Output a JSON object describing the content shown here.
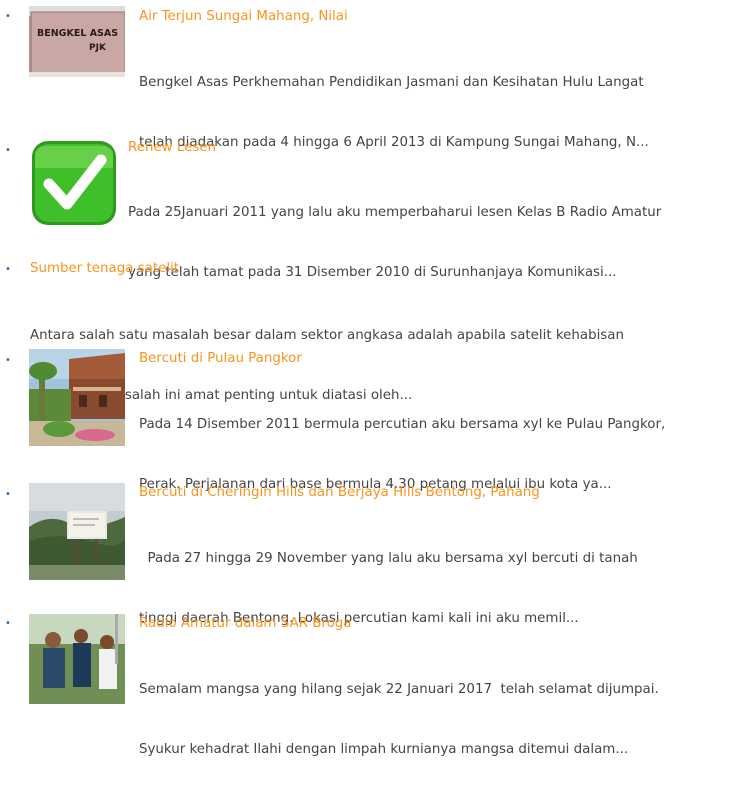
{
  "posts": [
    {
      "title": "Air Terjun Sungai Mahang, Nilai",
      "line1": "Bengkel Asas Perkhemahan Pendidikan Jasmani dan Kesihatan Hulu Langat",
      "line2": "telah diadakan pada 4 hingga 6 April 2013 di Kampung Sungai Mahang, N...",
      "thumb_text": [
        "BENGKEL ASAS",
        "PJK"
      ]
    },
    {
      "title": "Renew Lesen",
      "line1": "Pada 25Januari 2011 yang lalu aku memperbaharui lesen Kelas B Radio Amatur",
      "line2": "yang telah tamat pada 31 Disember 2010 di Surunhanjaya Komunikasi..."
    },
    {
      "title": "Sumber tenaga satelit",
      "line1": "Antara salah satu masalah besar dalam sektor angkasa adalah apabila satelit kehabisan",
      "line2": "bahan api. Masalah ini amat penting untuk diatasi oleh..."
    },
    {
      "title": "Bercuti di Pulau Pangkor",
      "line1": "Pada 14 Disember 2011 bermula percutian aku bersama xyl ke Pulau Pangkor,",
      "line2": "Perak. Perjalanan dari base bermula 4.30 petang melalui ibu kota ya..."
    },
    {
      "title": "Bercuti di Cheringin Hills dan Berjaya Hills Bentong, Pahang",
      "line1": "  Pada 27 hingga 29 November yang lalu aku bersama xyl bercuti di tanah",
      "line2": "tinggi daerah Bentong. Lokasi percutian kami kali ini aku memil..."
    },
    {
      "title": "Radio Amatur dalam SAR Broga",
      "line1": "Semalam mangsa yang hilang sejak 22 Januari 2017  telah selamat dijumpai.",
      "line2": "Syukur kehadrat Ilahi dengan limpah kurnianya mangsa ditemui dalam..."
    }
  ],
  "bullet_glyph": "•",
  "colors": {
    "title": "#f7941d",
    "text": "#444444",
    "bullet": "#2b6aa8"
  }
}
